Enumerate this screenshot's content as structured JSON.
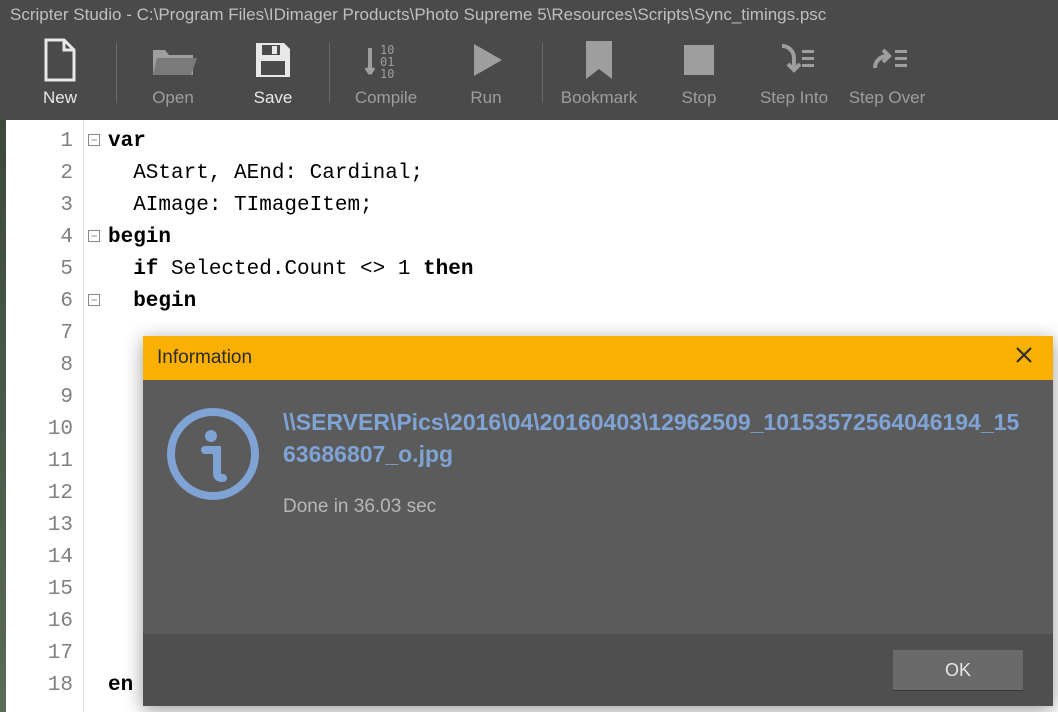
{
  "window": {
    "title": "Scripter Studio - C:\\Program Files\\IDimager Products\\Photo Supreme 5\\Resources\\Scripts\\Sync_timings.psc"
  },
  "toolbar": {
    "new": "New",
    "open": "Open",
    "save": "Save",
    "compile": "Compile",
    "run": "Run",
    "bookmark": "Bookmark",
    "stop": "Stop",
    "stepinto": "Step Into",
    "stepover": "Step Over"
  },
  "gutter": {
    "lines": [
      "1",
      "2",
      "3",
      "4",
      "5",
      "6",
      "7",
      "8",
      "9",
      "10",
      "11",
      "12",
      "13",
      "14",
      "15",
      "16",
      "17",
      "18"
    ]
  },
  "code": {
    "l1a": "var",
    "l2": "  AStart, AEnd: Cardinal;",
    "l3": "  AImage: TImageItem;",
    "l4a": "begin",
    "l5a": "  if",
    "l5b": " Selected.Count <> 1 ",
    "l5c": "then",
    "l6a": "  begin",
    "l18a": "en"
  },
  "dialog": {
    "title": "Information",
    "path": "\\\\SERVER\\Pics\\2016\\04\\20160403\\12962509_10153572564046194_1563686807_o.jpg",
    "done": "Done in 36.03 sec",
    "ok": "OK"
  }
}
